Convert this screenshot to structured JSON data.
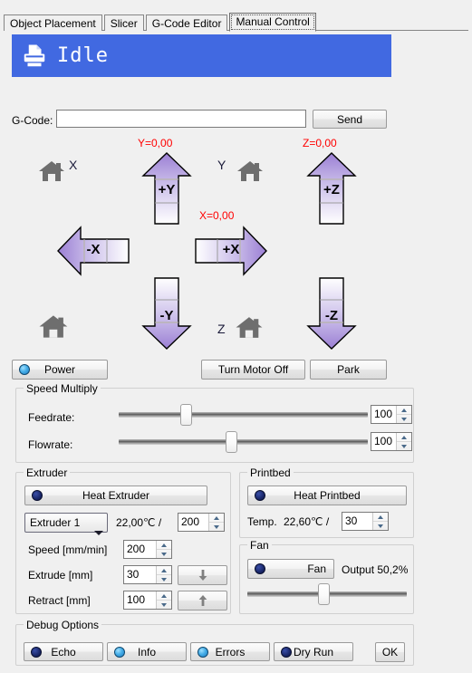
{
  "tabs": [
    {
      "label": "Object Placement",
      "active": false
    },
    {
      "label": "Slicer",
      "active": false
    },
    {
      "label": "G-Code Editor",
      "active": false
    },
    {
      "label": "Manual Control",
      "active": true
    }
  ],
  "banner": {
    "status": "Idle",
    "icon": "printer-icon",
    "background": "#4169e1",
    "text_color": "#ffffff"
  },
  "gcode": {
    "label": "G-Code:",
    "value": "",
    "placeholder": "",
    "send_label": "Send"
  },
  "jog": {
    "coord_color": "#ff0000",
    "readouts": {
      "y": "Y=0,00",
      "x": "X=0,00",
      "z": "Z=0,00"
    },
    "home_labels": {
      "x": "X",
      "y": "Y",
      "z": "Z"
    },
    "home_icons": {
      "x": "home-icon",
      "y": "home-icon",
      "z": "home-icon",
      "all": "home-icon"
    },
    "arrows": {
      "y_plus": "+Y",
      "y_minus": "-Y",
      "x_plus": "+X",
      "x_minus": "-X",
      "z_plus": "+Z",
      "z_minus": "-Z"
    }
  },
  "controls": {
    "power": {
      "label": "Power",
      "led": "on"
    },
    "motor_off": {
      "label": "Turn Motor Off"
    },
    "park": {
      "label": "Park"
    }
  },
  "speed_multiply": {
    "caption": "Speed Multiply",
    "feedrate": {
      "label": "Feedrate:",
      "value": "100",
      "thumb_percent": 27
    },
    "flowrate": {
      "label": "Flowrate:",
      "value": "100",
      "thumb_percent": 45
    }
  },
  "extruder": {
    "caption": "Extruder",
    "heat_button": {
      "label": "Heat Extruder",
      "led": "off"
    },
    "selector": {
      "value": "Extruder 1"
    },
    "current_temp": "22,00℃ /",
    "target_temp": "200",
    "speed": {
      "label": "Speed [mm/min]",
      "value": "200"
    },
    "extrude": {
      "label": "Extrude [mm]",
      "value": "30",
      "icon": "arrow-down-icon"
    },
    "retract": {
      "label": "Retract [mm]",
      "value": "100",
      "icon": "arrow-up-icon"
    }
  },
  "printbed": {
    "caption": "Printbed",
    "heat_button": {
      "label": "Heat Printbed",
      "led": "off"
    },
    "temp_label": "Temp.",
    "current_temp": "22,60℃ /",
    "target_temp": "30"
  },
  "fan": {
    "caption": "Fan",
    "button": {
      "label": "Fan",
      "led": "off"
    },
    "output": "Output 50,2%",
    "slider_percent": 48
  },
  "debug": {
    "caption": "Debug Options",
    "options": [
      {
        "label": "Echo",
        "led": "off"
      },
      {
        "label": "Info",
        "led": "on"
      },
      {
        "label": "Errors",
        "led": "on"
      },
      {
        "label": "Dry Run",
        "led": "off"
      }
    ],
    "ok_label": "OK"
  }
}
